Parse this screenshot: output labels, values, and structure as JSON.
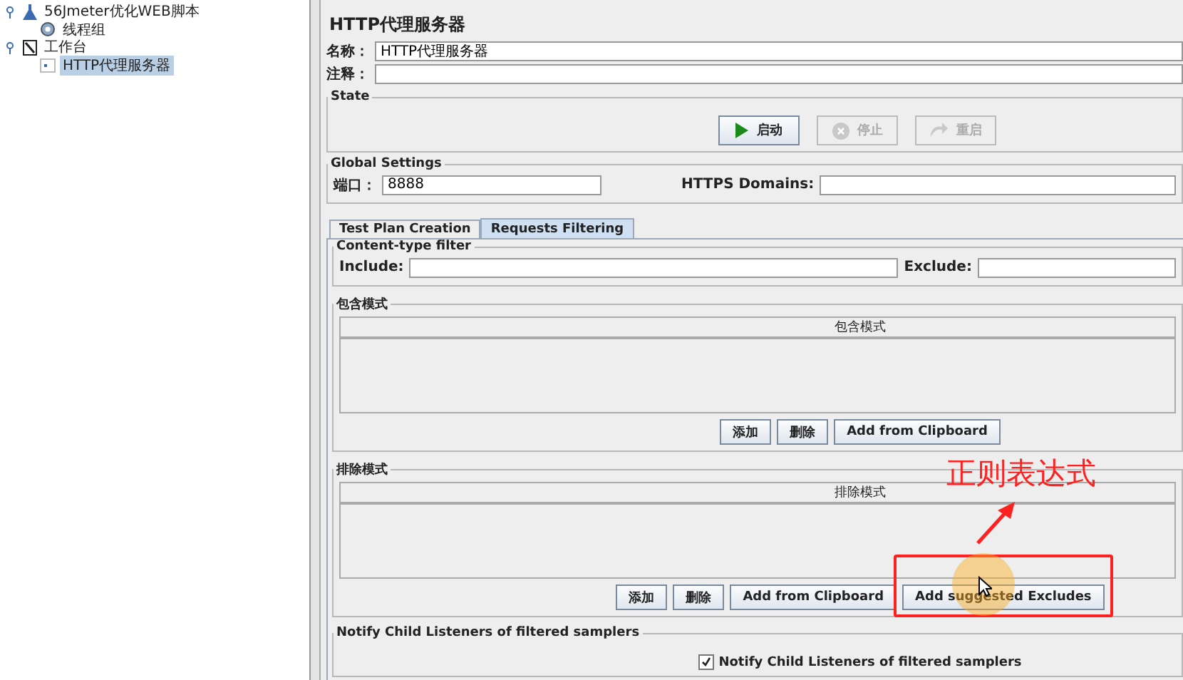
{
  "tree": [
    {
      "label": "56Jmeter优化WEB脚本",
      "kind": "testplan",
      "expanded": true,
      "selected": false,
      "children": [
        {
          "label": "线程组",
          "kind": "gear",
          "selected": false
        }
      ]
    },
    {
      "label": "工作台",
      "kind": "workbench",
      "expanded": true,
      "selected": false,
      "children": [
        {
          "label": "HTTP代理服务器",
          "kind": "proxy",
          "selected": true
        }
      ]
    }
  ],
  "editor": {
    "title": "HTTP代理服务器",
    "name_label": "名称：",
    "name_value": "HTTP代理服务器",
    "comment_label": "注释：",
    "state": {
      "legend": "State",
      "buttons": [
        {
          "label": "启动",
          "kind": "start",
          "disabled": false
        },
        {
          "label": "停止",
          "kind": "stop",
          "disabled": true
        },
        {
          "label": "重启",
          "kind": "restart",
          "disabled": true
        }
      ]
    },
    "global": {
      "legend": "Global Settings",
      "port_label": "端口：",
      "port_value": "8888",
      "https_label": "HTTPS Domains:"
    },
    "tabs": [
      {
        "label": "Test Plan Creation",
        "selected": false
      },
      {
        "label": "Requests Filtering",
        "selected": true
      }
    ],
    "content_filter": {
      "legend": "Content-type filter",
      "include_label": "Include:",
      "exclude_label": "Exclude:"
    },
    "patterns": [
      {
        "legend": "包含模式",
        "column": "包含模式",
        "buttons": [
          "添加",
          "删除",
          "Add from Clipboard"
        ]
      },
      {
        "legend": "排除模式",
        "column": "排除模式",
        "buttons": [
          "添加",
          "删除",
          "Add from Clipboard",
          "Add suggested Excludes"
        ]
      }
    ],
    "notify": {
      "legend": "Notify Child Listeners of filtered samplers",
      "checkbox_label": "Notify Child Listeners of filtered samplers",
      "checked": true
    }
  },
  "annotation": {
    "text": "正则表达式"
  }
}
